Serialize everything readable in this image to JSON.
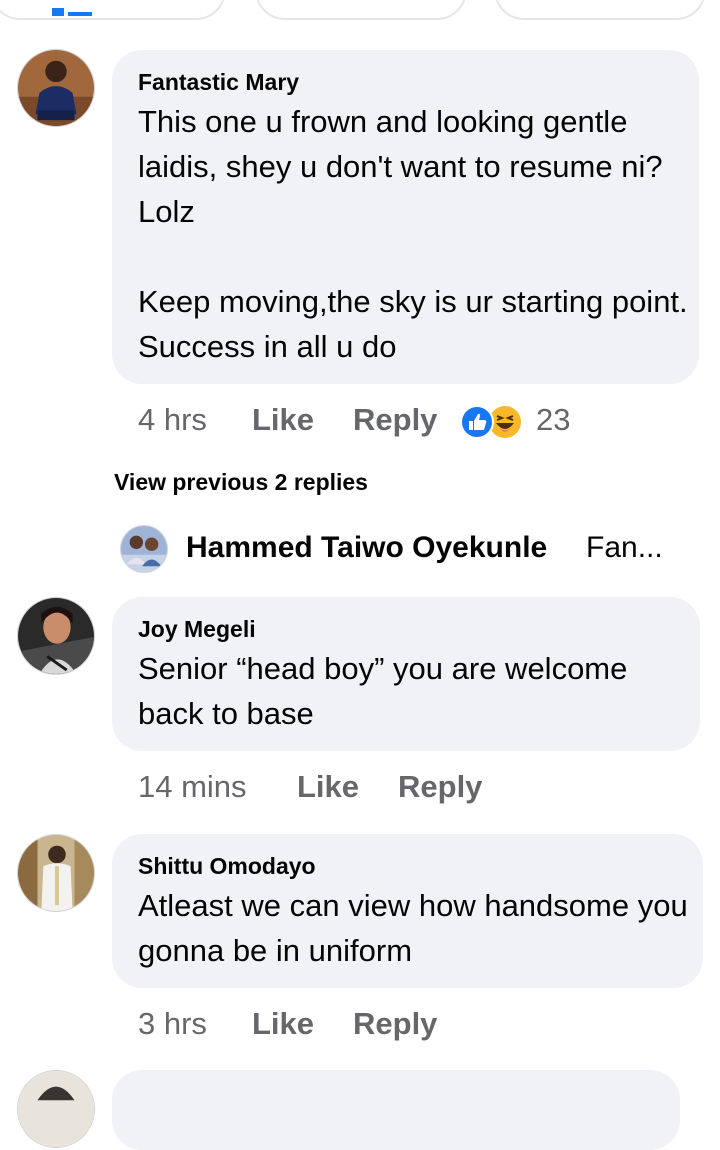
{
  "comments": [
    {
      "author": "Fantastic Mary",
      "text": "This one u frown and looking gentle laidis, shey u don't want to resume ni? Lolz\n\nKeep moving,the sky is ur starting point. Success in all u do",
      "time": "4 hrs",
      "like_label": "Like",
      "reply_label": "Reply",
      "reaction_count": "23",
      "reaction_icons": [
        "like-reaction-icon",
        "haha-reaction-icon"
      ]
    },
    {
      "author": "Joy Megeli",
      "text": "Senior “head boy” you are welcome back to base",
      "time": "14 mins",
      "like_label": "Like",
      "reply_label": "Reply"
    },
    {
      "author": "Shittu Omodayo",
      "text": "Atleast we can view how handsome you gonna be in uniform",
      "time": "3 hrs",
      "like_label": "Like",
      "reply_label": "Reply"
    }
  ],
  "replies_thread": {
    "view_previous_label": "View previous 2 replies",
    "latest_reply_author": "Hammed Taiwo Oyekunle",
    "latest_reply_preview": "Fan..."
  },
  "colors": {
    "bubble": "#f0f2f5",
    "meta_text": "#65676b",
    "like_blue": "#1877f2",
    "haha_yellow": "#f7b928"
  }
}
